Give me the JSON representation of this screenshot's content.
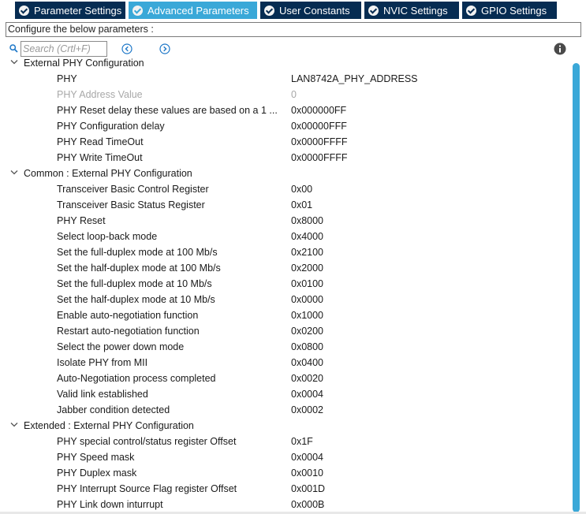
{
  "tabs": [
    {
      "label": "Parameter Settings",
      "active": false
    },
    {
      "label": "Advanced Parameters",
      "active": true
    },
    {
      "label": "User Constants",
      "active": false
    },
    {
      "label": "NVIC Settings",
      "active": false
    },
    {
      "label": "GPIO Settings",
      "active": false
    }
  ],
  "config_label": "Configure the below parameters :",
  "search": {
    "placeholder": "Search (Crtl+F)"
  },
  "colors": {
    "tab_bg": "#062c52",
    "tab_active_bg": "#3aa8d8",
    "scrollbar": "#3aa8d8",
    "disabled_text": "#a8a8a8"
  },
  "icons": [
    "search-icon",
    "previous-icon",
    "next-icon",
    "info-icon",
    "chevron-down-icon",
    "check-circle-icon"
  ],
  "groups": [
    {
      "title": "External PHY Configuration",
      "params": [
        {
          "name": "PHY",
          "value": "LAN8742A_PHY_ADDRESS",
          "disabled": false
        },
        {
          "name": "PHY Address Value",
          "value": "0",
          "disabled": true
        },
        {
          "name": "PHY Reset delay these values are based on a 1 ...",
          "value": "0x000000FF",
          "disabled": false
        },
        {
          "name": "PHY Configuration delay",
          "value": "0x00000FFF",
          "disabled": false
        },
        {
          "name": "PHY Read TimeOut",
          "value": "0x0000FFFF",
          "disabled": false
        },
        {
          "name": "PHY Write TimeOut",
          "value": "0x0000FFFF",
          "disabled": false
        }
      ]
    },
    {
      "title": "Common : External PHY Configuration",
      "params": [
        {
          "name": "Transceiver Basic Control Register",
          "value": "0x00",
          "disabled": false
        },
        {
          "name": "Transceiver Basic Status Register",
          "value": "0x01",
          "disabled": false
        },
        {
          "name": "PHY Reset",
          "value": "0x8000",
          "disabled": false
        },
        {
          "name": "Select loop-back mode",
          "value": "0x4000",
          "disabled": false
        },
        {
          "name": "Set the full-duplex mode at 100 Mb/s",
          "value": "0x2100",
          "disabled": false
        },
        {
          "name": "Set the half-duplex mode at 100 Mb/s",
          "value": "0x2000",
          "disabled": false
        },
        {
          "name": "Set the full-duplex mode at 10 Mb/s",
          "value": "0x0100",
          "disabled": false
        },
        {
          "name": "Set the half-duplex mode at 10 Mb/s",
          "value": "0x0000",
          "disabled": false
        },
        {
          "name": "Enable auto-negotiation function",
          "value": "0x1000",
          "disabled": false
        },
        {
          "name": "Restart auto-negotiation function",
          "value": "0x0200",
          "disabled": false
        },
        {
          "name": "Select the power down mode",
          "value": "0x0800",
          "disabled": false
        },
        {
          "name": "Isolate PHY from MII",
          "value": "0x0400",
          "disabled": false
        },
        {
          "name": "Auto-Negotiation process completed",
          "value": "0x0020",
          "disabled": false
        },
        {
          "name": "Valid link established",
          "value": "0x0004",
          "disabled": false
        },
        {
          "name": "Jabber condition detected",
          "value": "0x0002",
          "disabled": false
        }
      ]
    },
    {
      "title": "Extended : External PHY Configuration",
      "params": [
        {
          "name": "PHY special control/status register Offset",
          "value": "0x1F",
          "disabled": false
        },
        {
          "name": "PHY Speed mask",
          "value": "0x0004",
          "disabled": false
        },
        {
          "name": "PHY Duplex mask",
          "value": "0x0010",
          "disabled": false
        },
        {
          "name": "PHY Interrupt Source Flag register Offset",
          "value": "0x001D",
          "disabled": false
        },
        {
          "name": "PHY Link down inturrupt",
          "value": "0x000B",
          "disabled": false
        }
      ]
    }
  ]
}
